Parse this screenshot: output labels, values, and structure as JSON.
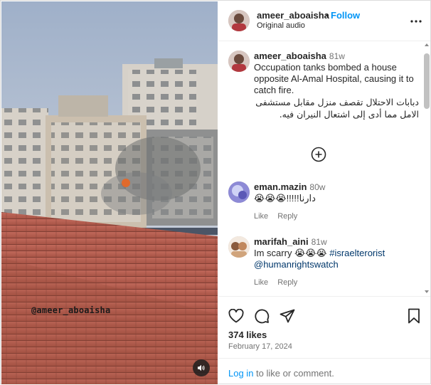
{
  "post": {
    "author": "ameer_aboaisha",
    "follow_label": "Follow",
    "audio_label": "Original audio",
    "media": {
      "watermark": "@ameer_aboaisha",
      "sound_icon": "speaker-icon"
    }
  },
  "caption": {
    "user": "ameer_aboaisha",
    "time": "81w",
    "text_en": "Occupation tanks bombed a house opposite Al-Amal Hospital, causing it to catch fire.",
    "text_ar": "دبابات الاحتلال تقصف منزل مقابل مستشفى الامل مما أدى إلى اشتعال النيران فيه."
  },
  "load_more_icon": "plus-circle-icon",
  "comments": [
    {
      "user": "eman.mazin",
      "time": "80w",
      "text": "😭😭😭!!!!!دارنا",
      "like_label": "Like",
      "reply_label": "Reply"
    },
    {
      "user": "marifah_aini",
      "time": "81w",
      "text": "Im scarry 😭😭😭 ",
      "hashtag": "#israelterorist",
      "mention": "@humanrightswatch",
      "like_label": "Like",
      "reply_label": "Reply"
    }
  ],
  "actions": {
    "icons": [
      "heart-icon",
      "comment-icon",
      "share-icon",
      "bookmark-icon"
    ],
    "likes": "374 likes",
    "date": "February 17, 2024",
    "login_link": "Log in",
    "login_rest": " to like or comment."
  },
  "colors": {
    "link_blue": "#0095f6",
    "mention_blue": "#00376b",
    "muted_text": "#737373",
    "border": "#dbdbdb"
  }
}
